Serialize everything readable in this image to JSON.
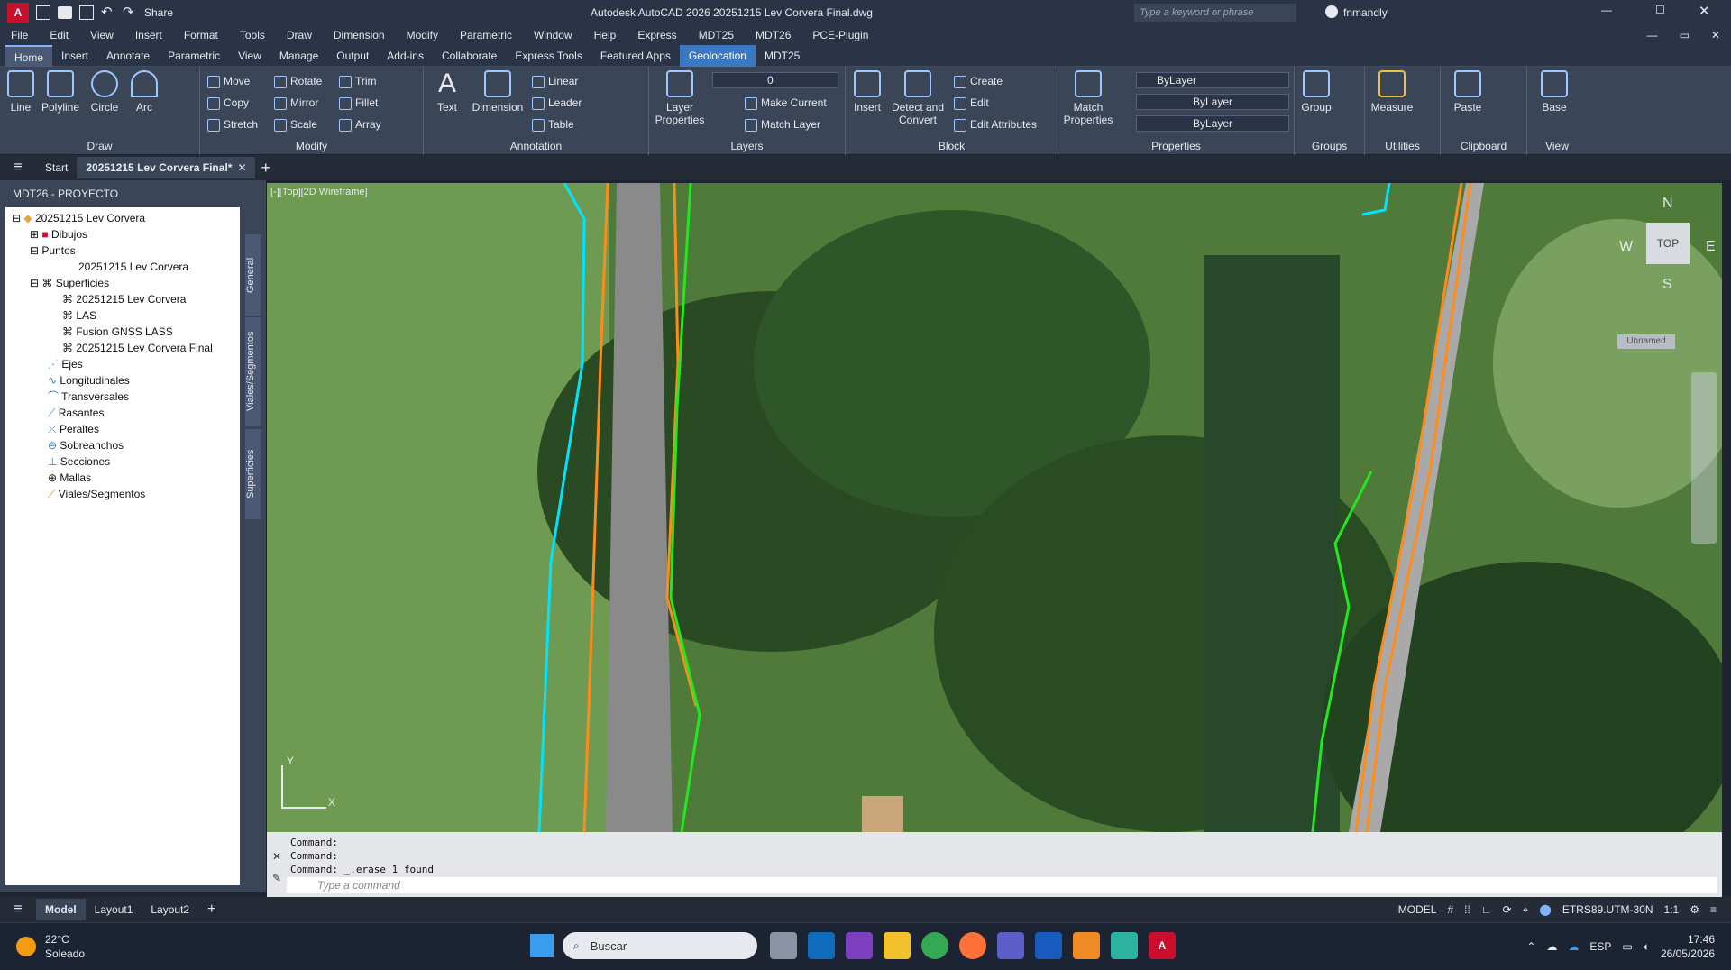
{
  "titlebar": {
    "share": "Share",
    "app_title": "Autodesk AutoCAD 2026   20251215 Lev Corvera Final.dwg",
    "search_placeholder": "Type a keyword or phrase",
    "user": "fnmandly"
  },
  "menu": [
    "File",
    "Edit",
    "View",
    "Insert",
    "Format",
    "Tools",
    "Draw",
    "Dimension",
    "Modify",
    "Parametric",
    "Window",
    "Help",
    "Express",
    "MDT25",
    "MDT26",
    "PCE-Plugin"
  ],
  "tabs": [
    "Home",
    "Insert",
    "Annotate",
    "Parametric",
    "View",
    "Manage",
    "Output",
    "Add-ins",
    "Collaborate",
    "Express Tools",
    "Featured Apps",
    "Geolocation",
    "MDT25"
  ],
  "ribbon": {
    "draw": {
      "label": "Draw",
      "items": [
        "Line",
        "Polyline",
        "Circle",
        "Arc"
      ]
    },
    "modify": {
      "label": "Modify",
      "items": [
        "Move",
        "Rotate",
        "Trim",
        "Copy",
        "Mirror",
        "Fillet",
        "Stretch",
        "Scale",
        "Array"
      ]
    },
    "annotation": {
      "label": "Annotation",
      "items": [
        "Text",
        "Dimension",
        "Linear",
        "Leader",
        "Table"
      ]
    },
    "layers": {
      "label": "Layers",
      "items": [
        "Layer Properties",
        "Make Current",
        "Match Layer"
      ],
      "current": "0"
    },
    "block": {
      "label": "Block",
      "items": [
        "Insert",
        "Detect and Convert",
        "Create",
        "Edit",
        "Edit Attributes"
      ]
    },
    "properties": {
      "label": "Properties",
      "items": [
        "Match Properties",
        "ByLayer",
        "ByLayer",
        "ByLayer"
      ]
    },
    "groups": {
      "label": "Groups",
      "items": [
        "Group"
      ]
    },
    "utilities": {
      "label": "Utilities",
      "items": [
        "Measure"
      ]
    },
    "clipboard": {
      "label": "Clipboard",
      "items": [
        "Paste"
      ]
    },
    "view": {
      "label": "View",
      "items": [
        "Base"
      ]
    }
  },
  "doctabs": {
    "start": "Start",
    "current": "20251215 Lev Corvera Final*"
  },
  "palette": {
    "title": "MDT26 - PROYECTO",
    "tree": [
      "20251215 Lev Corvera",
      "Dibujos",
      "Puntos",
      "20251215 Lev Corvera",
      "Superficies",
      "20251215 Lev Corvera",
      "LAS",
      "Fusion GNSS LASS",
      "20251215 Lev Corvera Final",
      "Ejes",
      "Longitudinales",
      "Transversales",
      "Rasantes",
      "Peraltes",
      "Sobreanchos",
      "Secciones",
      "Mallas",
      "Viales/Segmentos"
    ],
    "side_tabs": [
      "General",
      "Viales/Segmentos",
      "Superficies"
    ]
  },
  "viewport": {
    "label": "[-][Top][2D Wireframe]",
    "compass": {
      "n": "N",
      "s": "S",
      "e": "E",
      "w": "W",
      "top": "TOP",
      "wcs": "Unnamed"
    },
    "ucs": {
      "x": "X",
      "y": "Y"
    }
  },
  "command": {
    "history": [
      "Command:",
      "Command:",
      "Command: _.erase 1 found"
    ],
    "placeholder": "Type a command"
  },
  "status": {
    "tabs": [
      "Model",
      "Layout1",
      "Layout2"
    ],
    "model": "MODEL",
    "coord": "ETRS89.UTM-30N",
    "scale": "1:1"
  },
  "taskbar": {
    "weather_temp": "22°C",
    "weather_desc": "Soleado",
    "search": "Buscar",
    "lang": "ESP",
    "time": "17:46",
    "date": "26/05/2026"
  }
}
